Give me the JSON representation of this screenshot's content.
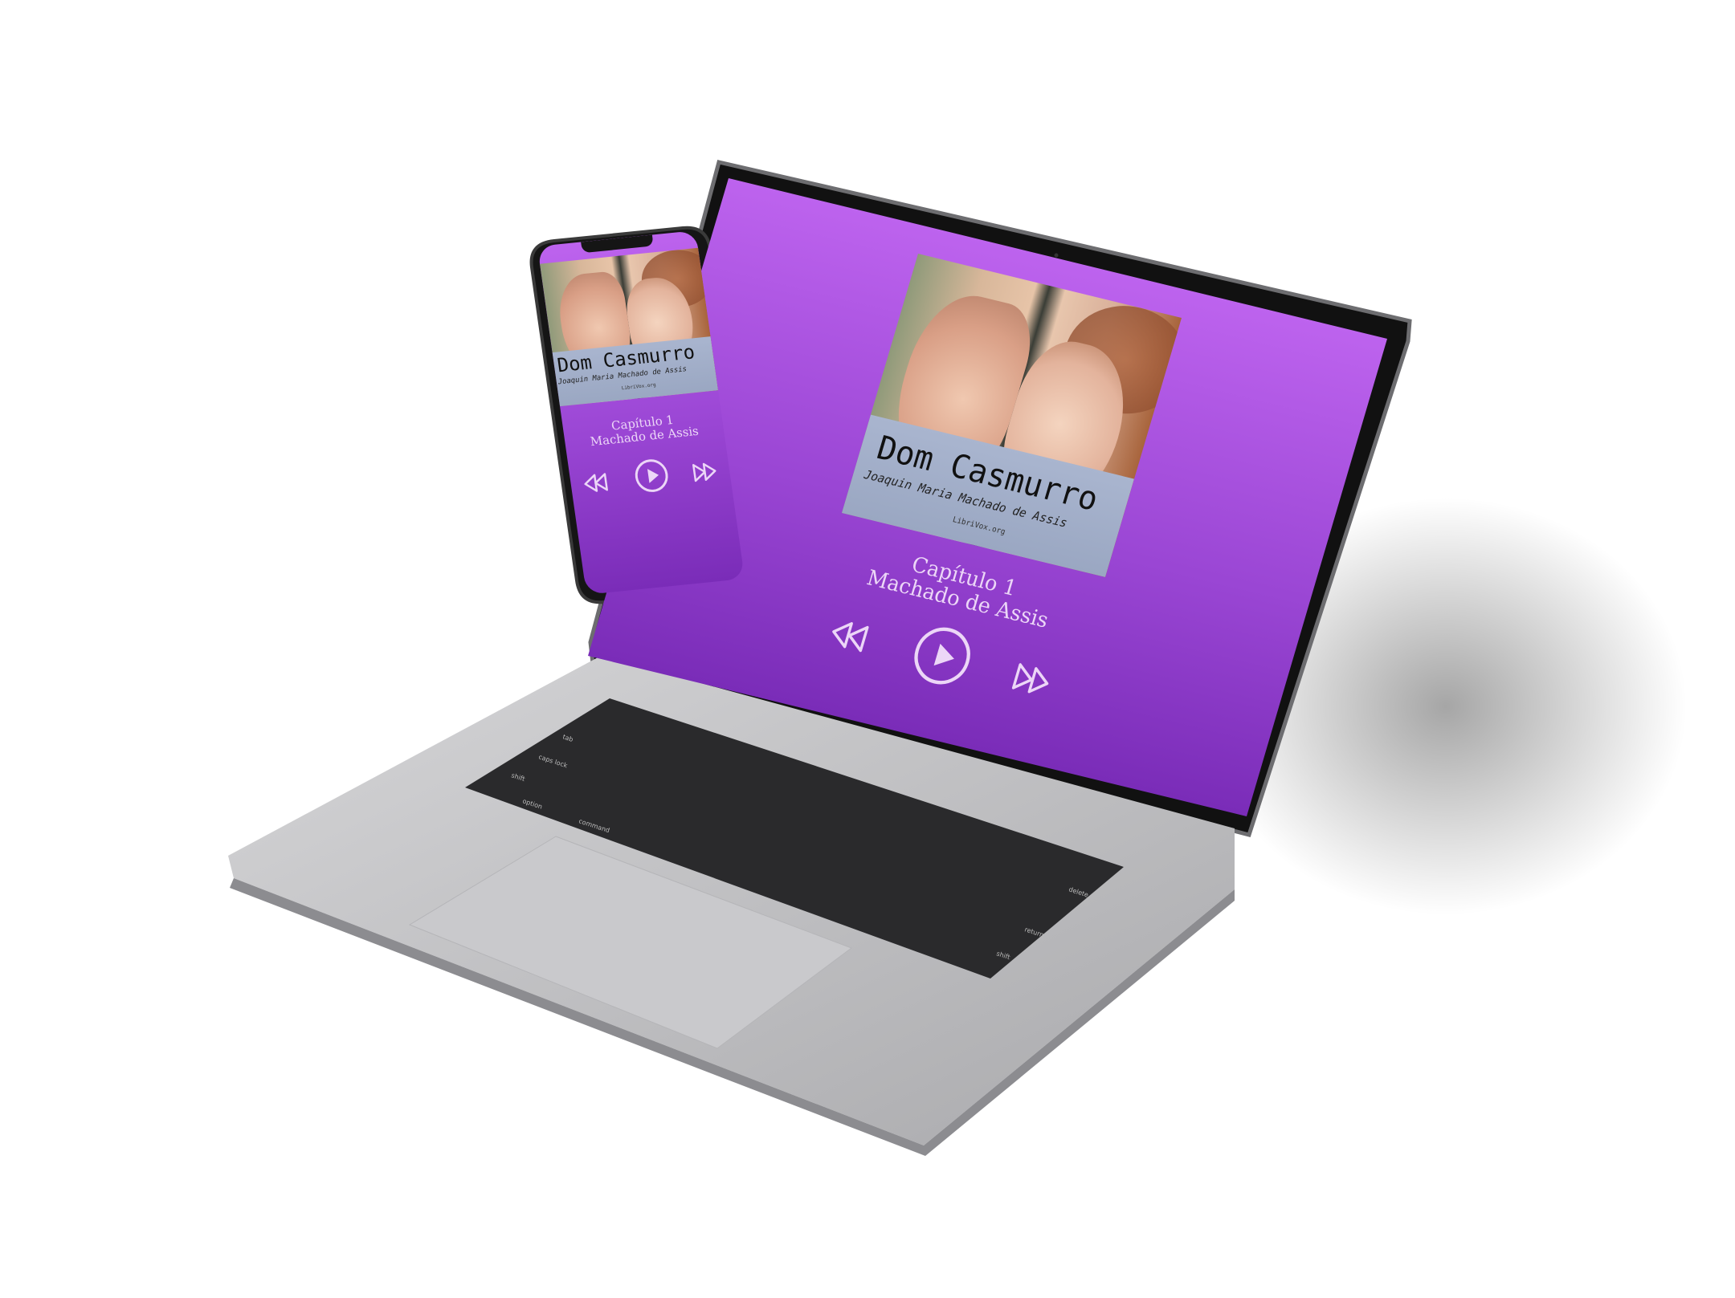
{
  "player": {
    "cover": {
      "title": "Dom Casmurro",
      "author": "Joaquin Maria Machado de Assis",
      "site": "LibriVox.org"
    },
    "track_title": "Capítulo 1",
    "artist": "Machado de Assis",
    "controls": {
      "rewind_icon": "rewind-icon",
      "play_icon": "play-circle-icon",
      "forward_icon": "fast-forward-icon"
    }
  },
  "keyboard": {
    "keys": [
      "tab",
      "caps lock",
      "shift",
      "option",
      "command",
      "delete",
      "return",
      "shift"
    ]
  },
  "colors": {
    "gradient_top": "#bd63ee",
    "gradient_bottom": "#7a2cb8",
    "text": "#ecd6f7"
  }
}
